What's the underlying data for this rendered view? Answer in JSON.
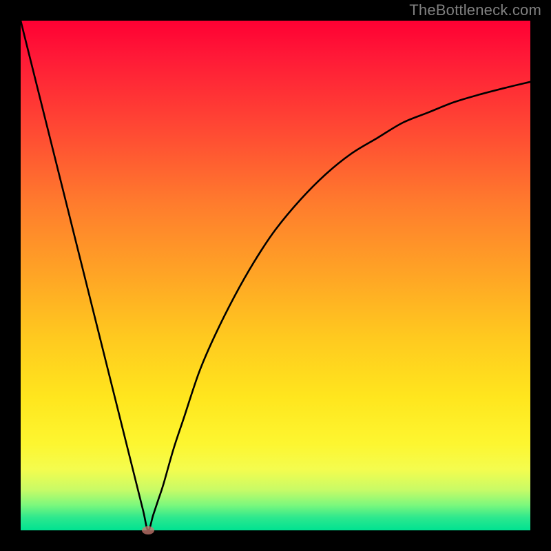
{
  "watermark": "TheBottleneck.com",
  "chart_data": {
    "type": "line",
    "title": "",
    "xlabel": "",
    "ylabel": "",
    "xlim": [
      0,
      100
    ],
    "ylim": [
      0,
      100
    ],
    "background": {
      "style": "vertical-gradient",
      "stops": [
        {
          "pos": 0.0,
          "color": "#ff0033"
        },
        {
          "pos": 0.22,
          "color": "#ff4b33"
        },
        {
          "pos": 0.5,
          "color": "#ffa525"
        },
        {
          "pos": 0.74,
          "color": "#ffe61e"
        },
        {
          "pos": 0.88,
          "color": "#f4fc4e"
        },
        {
          "pos": 0.95,
          "color": "#7df87c"
        },
        {
          "pos": 1.0,
          "color": "#00e291"
        }
      ]
    },
    "series": [
      {
        "name": "bottleneck-curve",
        "color": "#000000",
        "x": [
          0,
          2,
          5,
          8,
          10,
          12,
          15,
          18,
          20,
          22,
          24,
          25,
          26,
          27,
          28,
          30,
          32,
          35,
          38,
          42,
          46,
          50,
          55,
          60,
          65,
          70,
          75,
          80,
          85,
          90,
          95,
          100
        ],
        "y": [
          100,
          92,
          80,
          68,
          60,
          52,
          40,
          28,
          20,
          12,
          4,
          0,
          3,
          6,
          9,
          16,
          22,
          31,
          38,
          46,
          53,
          59,
          65,
          70,
          74,
          77,
          80,
          82,
          84,
          85.5,
          86.8,
          88
        ]
      }
    ],
    "marker": {
      "x": 25,
      "y": 0,
      "color": "#c97a70"
    }
  }
}
